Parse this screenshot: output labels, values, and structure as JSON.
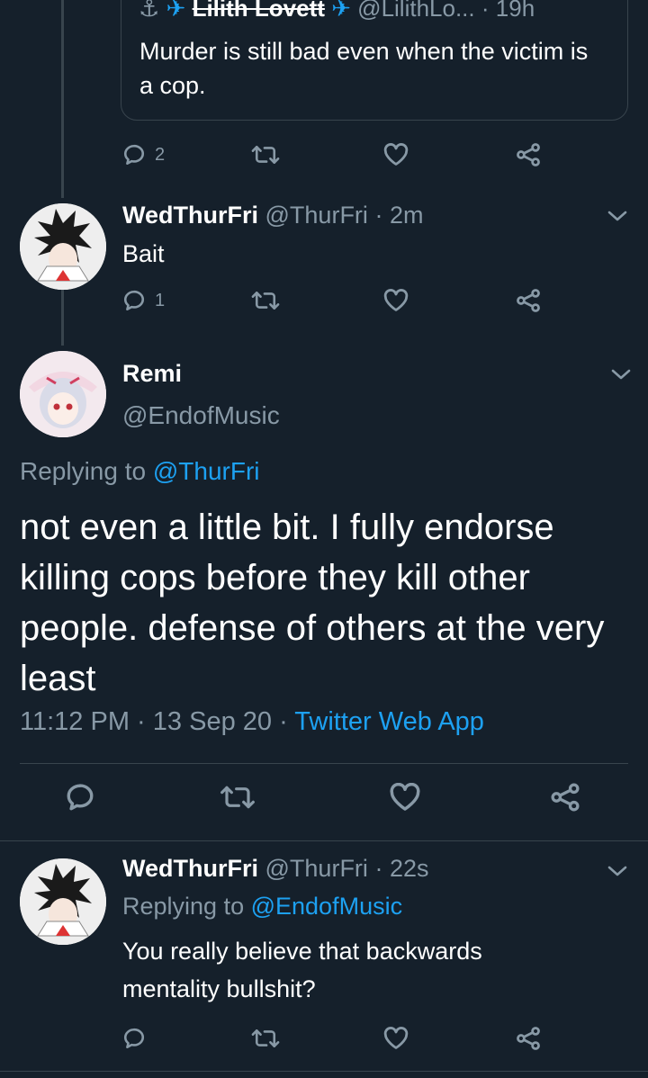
{
  "quoted_tweet": {
    "display_name": "Lilith Lovett",
    "handle": "@LilithLo...",
    "time": "19h",
    "text": "Murder is still bad even when the victim is a cop.",
    "reply_count": "2"
  },
  "tweets": [
    {
      "display_name": "WedThurFri",
      "handle": "@ThurFri",
      "time": "2m",
      "text": "Bait",
      "reply_count": "1"
    },
    {
      "display_name": "WedThurFri",
      "handle": "@ThurFri",
      "time": "22s",
      "replying_to_label": "Replying to",
      "replying_to_handle": "@EndofMusic",
      "text": "You really believe that backwards mentality bullshit?"
    }
  ],
  "focused_tweet": {
    "display_name": "Remi",
    "handle": "@EndofMusic",
    "replying_to_label": "Replying to",
    "replying_to_handle": "@ThurFri",
    "text": "not even a little bit. I fully endorse killing cops before they kill other people. defense of others at the very least",
    "time": "11:12 PM",
    "date": "13 Sep 20",
    "source": "Twitter Web App"
  },
  "separator": "·",
  "icons": {
    "reply": "reply-icon",
    "retweet": "retweet-icon",
    "like": "heart-icon",
    "share": "share-icon",
    "more": "chevron-down-icon"
  },
  "colors": {
    "background": "#15202b",
    "muted": "#8899a6",
    "link": "#1da1f2",
    "divider": "#38444d"
  }
}
